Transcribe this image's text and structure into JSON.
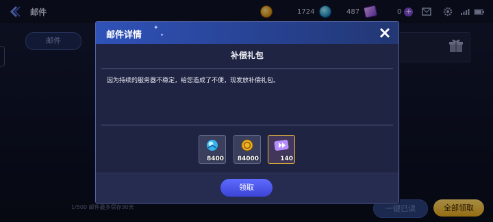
{
  "header": {
    "title": "邮件",
    "resources": [
      {
        "icon": "gold-coin-icon",
        "value": "1724"
      },
      {
        "icon": "blue-gem-icon",
        "value": "487"
      },
      {
        "icon": "purple-ticket-icon",
        "value": "0"
      }
    ]
  },
  "background": {
    "tab_label": "邮件",
    "footer_note": "1/500 邮件最多保存30天",
    "read_button": "一键已读",
    "claim_all_button": "全部领取"
  },
  "modal": {
    "title": "邮件详情",
    "subject": "补偿礼包",
    "body": "因为持续的服务器不稳定，给您造成了不便，现发放补偿礼包。",
    "items": [
      {
        "icon": "blue-gem-icon",
        "qty": "8400"
      },
      {
        "icon": "gold-coin-icon",
        "qty": "84000"
      },
      {
        "icon": "purple-ticket-icon",
        "qty": "140"
      }
    ],
    "claim_button": "领取"
  },
  "colors": {
    "accent": "#4f5cf0",
    "header_blue": "#2f52b8",
    "gold": "#e8b53a"
  }
}
